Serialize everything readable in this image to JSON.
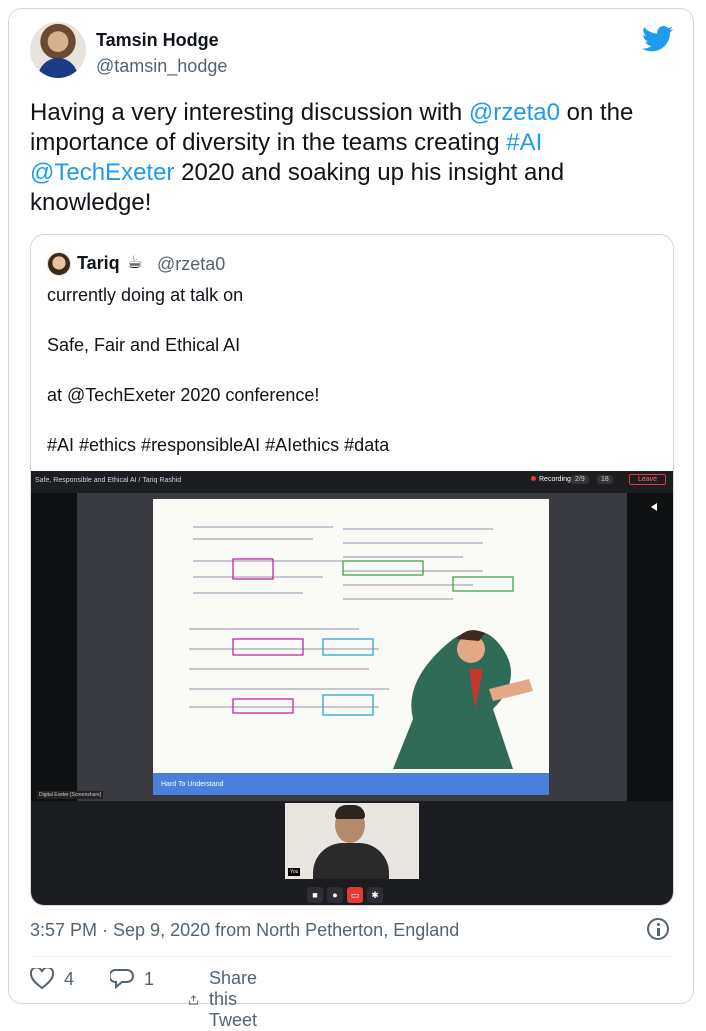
{
  "author": {
    "name": "Tamsin Hodge",
    "handle": "@tamsin_hodge"
  },
  "tweet": {
    "parts": [
      {
        "text": "Having a very interesting discussion with ",
        "type": "plain"
      },
      {
        "text": "@rzeta0",
        "type": "link"
      },
      {
        "text": " on the importance of diversity in the teams creating ",
        "type": "plain"
      },
      {
        "text": "#AI",
        "type": "link"
      },
      {
        "text": " ",
        "type": "plain"
      },
      {
        "text": "@TechExeter",
        "type": "link"
      },
      {
        "text": " 2020 and soaking up his insight and knowledge!",
        "type": "plain"
      }
    ]
  },
  "quote": {
    "name": "Tariq",
    "emoji": "☕",
    "handle": "@rzeta0",
    "lines": [
      "currently doing at talk on",
      "Safe, Fair and Ethical AI",
      "at @TechExeter 2020 conference!",
      "#AI #ethics #responsibleAI #AIethics #data"
    ],
    "media": {
      "session_title": "Safe, Responsible and Ethical AI / Tariq Rashid",
      "recording_label": "Recording",
      "count_a": "2/9",
      "count_b": "18",
      "leave_label": "Leave",
      "slide_caption": "Hard To Understand",
      "stage_label": "Digital Exeter [Screenshare]",
      "video_label": "You"
    }
  },
  "meta": {
    "timestamp": "3:57 PM · Sep 9, 2020 from North Petherton, England"
  },
  "actions": {
    "likes": "4",
    "replies": "1",
    "share_label": "Share this Tweet"
  },
  "colors": {
    "accent": "#1d9bf0",
    "muted": "#536471"
  }
}
